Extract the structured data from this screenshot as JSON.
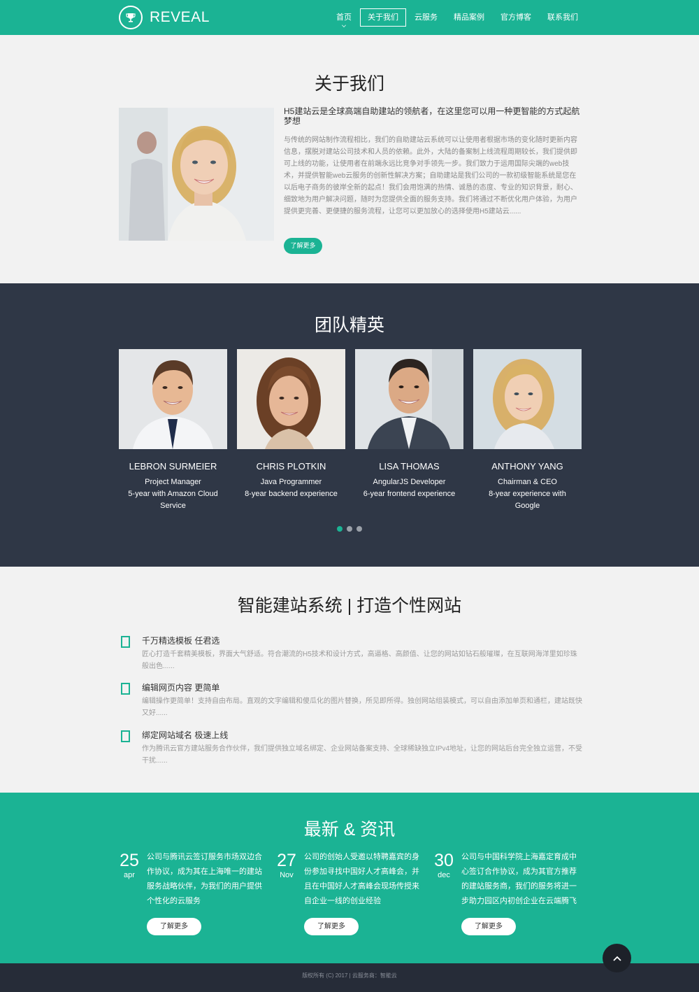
{
  "header": {
    "logo_text": "REVEAL",
    "nav": [
      "首页",
      "关于我们",
      "云服务",
      "精品案例",
      "官方博客",
      "联系我们"
    ],
    "active_index": 1
  },
  "about": {
    "title": "关于我们",
    "heading": "H5建站云是全球高端自助建站的领航者，在这里您可以用一种更智能的方式起航梦想",
    "body": "与传统的网站制作流程相比，我们的自助建站云系统可以让使用者根据市场的变化随时更新内容信息，摆脱对建站公司技术和人员的依赖。此外，大陆的备案制上线流程周期较长，我们提供即可上线的功能，让使用者在前端永远比竞争对手领先一步。我们致力于运用国际尖端的web技术，并提供智能web云服务的创新性解决方案；自助建站是我们公司的一款初级智能系统是您在以后电子商务的彼岸全新的起点！我们会用饱满的热情、诚恳的态度、专业的知识背景，耐心、细致地为用户解决问题，随时为您提供全面的服务支持。我们将通过不断优化用户体验，为用户提供更完善、更便捷的服务流程，让您可以更加放心的选择使用H5建站云......",
    "button": "了解更多"
  },
  "team": {
    "title": "团队精英",
    "members": [
      {
        "name": "LEBRON SURMEIER",
        "role": "Project Manager",
        "exp": "5-year with Amazon Cloud Service"
      },
      {
        "name": "CHRIS PLOTKIN",
        "role": "Java Programmer",
        "exp": "8-year backend experience"
      },
      {
        "name": "LISA THOMAS",
        "role": "AngularJS Developer",
        "exp": "6-year frontend experience"
      },
      {
        "name": "ANTHONY YANG",
        "role": "Chairman & CEO",
        "exp": "8-year experience with Google"
      }
    ]
  },
  "features": {
    "title": "智能建站系统 | 打造个性网站",
    "items": [
      {
        "title": "千万精选模板 任君选",
        "desc": "匠心打造千套精美模板，界面大气舒适。符合潮流的H5技术和设计方式，高逼格、高颜值、让您的网站如钻石般璀璨，在互联网海洋里如珍珠般出色......"
      },
      {
        "title": "编辑网页内容 更简单",
        "desc": "编辑操作更简单！支持自由布局。直观的文字编辑和傻瓜化的图片替换，所见即所得。独创网站组装模式，可以自由添加单页和通栏，建站既快又好......"
      },
      {
        "title": "绑定网站域名 极速上线",
        "desc": "作为腾讯云官方建站服务合作伙伴，我们提供独立域名绑定、企业网站备案支持、全球稀缺独立IPv4地址，让您的网站后台完全独立运营，不受干扰......"
      }
    ]
  },
  "news": {
    "title": "最新 & 资讯",
    "items": [
      {
        "day": "25",
        "month": "apr",
        "text": "公司与腾讯云签订服务市场双边合作协议，成为其在上海唯一的建站服务战略伙伴，为我们的用户提供个性化的云服务",
        "button": "了解更多"
      },
      {
        "day": "27",
        "month": "Nov",
        "text": "公司的创始人受邀以特聘嘉宾的身份参加寻找中国好人才高峰会，并且在中国好人才高峰会现场传授来自企业一线的创业经验",
        "button": "了解更多"
      },
      {
        "day": "30",
        "month": "dec",
        "text": "公司与中国科学院上海嘉定育成中心签订合作协议，成为其官方推荐的建站服务商，我们的服务将进一步助力园区内初创企业在云端腾飞",
        "button": "了解更多"
      }
    ]
  },
  "footer": {
    "text": "版权所有 (C) 2017 | 云服务商：智能云"
  },
  "colors": {
    "accent": "#1bb394",
    "dark": "#2f3746",
    "footer": "#262c38"
  }
}
